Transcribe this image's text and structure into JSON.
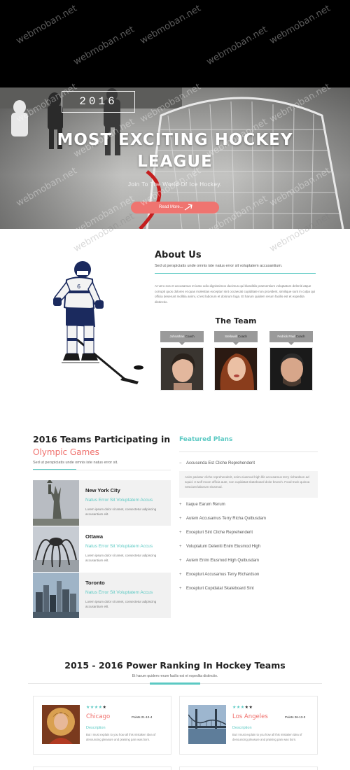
{
  "hero": {
    "year": "2016",
    "title_line1": "MOST EXCITING HOCKEY",
    "title_line2": "LEAGUE",
    "subtitle": "Join To The World Of Ice Hockey.",
    "button_label": "Read More..."
  },
  "about": {
    "title": "About Us",
    "lead": "Sed ut perspiciatis unde omnis iste natus error sit voluptatem accusantium.",
    "body": "At vero eos et accusamus et iusto odio dignissimos ducimus qui blanditiis praesentium voluptatum deleniti atque corrupti quos dolores et quas molestias excepturi sint occaecati cupiditate non provident, similique sunt in culpa qui officia deserunt mollitia animi, id est laborum et dolorum fuga. Et harum quidem rerum facilis est et expedita distinctio."
  },
  "team": {
    "title": "The Team",
    "members": [
      {
        "name": "Johnathan",
        "role": "Coach"
      },
      {
        "name": "Stellawill",
        "role": "Coach"
      },
      {
        "name": "Fedrick Paul",
        "role": "Coach"
      }
    ]
  },
  "teams": {
    "title": "2016 Teams Participating in",
    "title_accent": "Olympic Games",
    "lead": "Sed ut perspiciatis unde omnis iste natus error sit.",
    "cities": [
      {
        "name": "New York City",
        "subtitle": "Natus Error Sit Voluptatem Accus",
        "desc": "Lorem ipsum dolor sit amet, consectetur adipiscing accusantium elit."
      },
      {
        "name": "Ottawa",
        "subtitle": "Natus Error Sit Voluptatem Accus",
        "desc": "Lorem ipsum dolor sit amet, consectetur adipiscing accusantium elit."
      },
      {
        "name": "Toronto",
        "subtitle": "Natus Error Sit Voluptatem Accus",
        "desc": "Lorem ipsum dolor sit amet, consectetur adipiscing accusantium elit."
      }
    ]
  },
  "plans": {
    "title": "Featured Plans",
    "open_item": {
      "symbol": "−",
      "label": "Accusenda Est Cliche Reprehenderit",
      "body": "Anim pariatur cliche reprehenderit, enim eiusmod high life accusamus terry richardson ad squid. 3 wolf moon officia aute, non cupidatat skateboard dolor brunch. Food truck quinoa nesciunt laborum eiusmod."
    },
    "items": [
      {
        "symbol": "+",
        "label": "Itaque Earum Rerum"
      },
      {
        "symbol": "+",
        "label": "Autem Accusamus Terry Richa Quibusdam"
      },
      {
        "symbol": "+",
        "label": "Excepturi Sint Cliche Reprehenderit"
      },
      {
        "symbol": "+",
        "label": "Voluptatum Deleniti Enim Eiusmod High"
      },
      {
        "symbol": "+",
        "label": "Autem Enim Eiusmod High Quibusdam"
      },
      {
        "symbol": "+",
        "label": "Excepturi Accusamus Terry Richardson"
      },
      {
        "symbol": "+",
        "label": "Excepturi Cupidatat Skateboard Sint"
      }
    ]
  },
  "ranking": {
    "title": "2015 - 2016 Power Ranking In Hockey Teams",
    "lead": "Et harum quidem rerum facilis est et expedita distinctio.",
    "cards": [
      {
        "team": "Chicago",
        "points": "Points 21-12-4",
        "stars_on": "★★★★",
        "stars_off": "★",
        "desc_title": "Description",
        "desc": "But I must explain to you how all this mistaken idea of denouncing pleasure and praising pain was born."
      },
      {
        "team": "Los Angeles",
        "points": "Points 26-13-3",
        "stars_on": "★★★",
        "stars_off": "★★",
        "desc_title": "Description",
        "desc": "But I must explain to you how all this mistaken idea of denouncing pleasure and praising pain was born."
      }
    ]
  },
  "watermark": {
    "text": "webmoban.net"
  },
  "colors": {
    "accent": "#5bc9c3",
    "highlight": "#ef6f6b",
    "button": "#ef7470"
  }
}
